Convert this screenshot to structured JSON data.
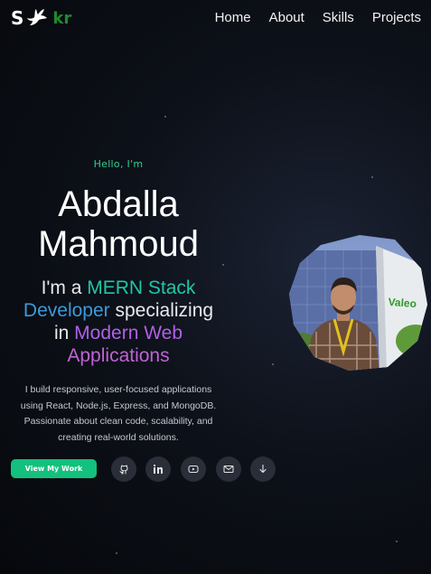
{
  "brand": {
    "first": "S",
    "second": "kr",
    "bird_icon": "bird-icon"
  },
  "nav": {
    "items": [
      {
        "label": "Home"
      },
      {
        "label": "About"
      },
      {
        "label": "Skills"
      },
      {
        "label": "Projects"
      }
    ]
  },
  "hero": {
    "greeting": "Hello, I'm",
    "name_line1": "Abdalla",
    "name_line2": "Mahmoud",
    "tagline": {
      "prefix": "I'm a ",
      "mern": "MERN Stack",
      "developer": "Developer",
      "middle": " specializing",
      "in": "in ",
      "modern": "Modern Web",
      "applications": "Applications"
    },
    "description": "I build responsive, user-focused applications using React, Node.js, Express, and MongoDB. Passionate about clean code, scalability, and creating real-world solutions.",
    "cta_label": "View My Work",
    "photo_sign_text": "Valeo"
  },
  "social": [
    {
      "icon": "github-icon"
    },
    {
      "icon": "linkedin-icon"
    },
    {
      "icon": "youtube-icon"
    },
    {
      "icon": "mail-icon"
    },
    {
      "icon": "arrow-down-icon"
    }
  ],
  "colors": {
    "accent_green": "#13c07d",
    "greeting_green": "#2fd08d",
    "mern_teal": "#1fc7a8",
    "developer_blue": "#3c9ad9",
    "modern_purple": "#b060e6",
    "logo_green": "#1f8a2e",
    "background": "#06080c"
  }
}
